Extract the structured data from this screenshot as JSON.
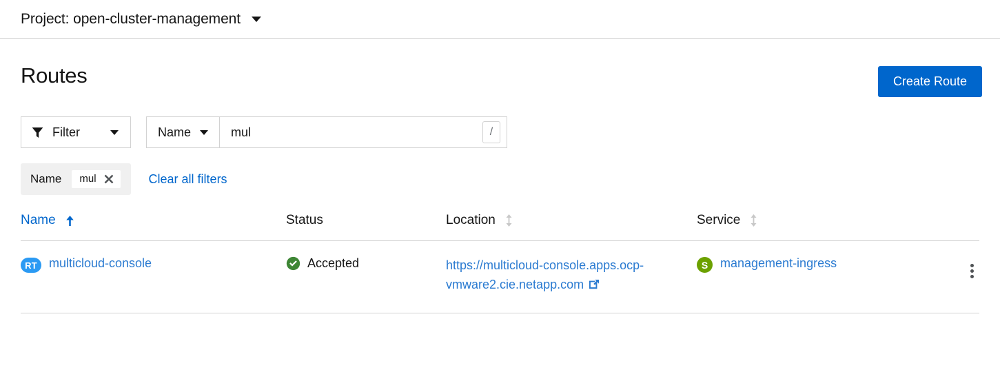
{
  "masthead": {
    "project_label": "Project: open-cluster-management",
    "caret_icon": "chevron-down-icon"
  },
  "page": {
    "title": "Routes",
    "create_button": "Create Route"
  },
  "toolbar": {
    "filter_button": {
      "label": "Filter",
      "icon": "funnel-icon",
      "caret_icon": "chevron-down-icon"
    },
    "attribute_select": {
      "label": "Name",
      "caret_icon": "chevron-down-icon"
    },
    "search": {
      "value": "mul",
      "placeholder": "",
      "shortcut_key": "/"
    }
  },
  "filter_chips": {
    "group_label": "Name",
    "chips": [
      {
        "text": "mul",
        "close_icon": "close-icon"
      }
    ],
    "clear_all_label": "Clear all filters"
  },
  "table": {
    "columns": [
      {
        "label": "Name",
        "sort": "asc",
        "sort_icon": "sort-arrow-up-icon"
      },
      {
        "label": "Status",
        "sort": "none",
        "sort_icon": ""
      },
      {
        "label": "Location",
        "sort": "none",
        "sort_icon": "sort-arrows-icon"
      },
      {
        "label": "Service",
        "sort": "none",
        "sort_icon": "sort-arrows-icon"
      }
    ],
    "rows": [
      {
        "name": {
          "badge": "RT",
          "badge_color": "#2b9af3",
          "label": "multicloud-console"
        },
        "status": {
          "icon": "check-circle-icon",
          "color": "#3e8635",
          "label": "Accepted"
        },
        "location": {
          "url_text": "https://multicloud-console.apps.ocp-vmware2.cie.netapp.com",
          "external_icon": "external-link-icon"
        },
        "service": {
          "badge": "S",
          "badge_color": "#6ca100",
          "label": "management-ingress"
        },
        "actions_icon": "kebab-menu-icon"
      }
    ]
  },
  "colors": {
    "primary": "#0066cc",
    "link": "#2b7bd1",
    "success": "#3e8635",
    "border": "#d2d2d2",
    "chip_bg": "#f0f0f0"
  }
}
